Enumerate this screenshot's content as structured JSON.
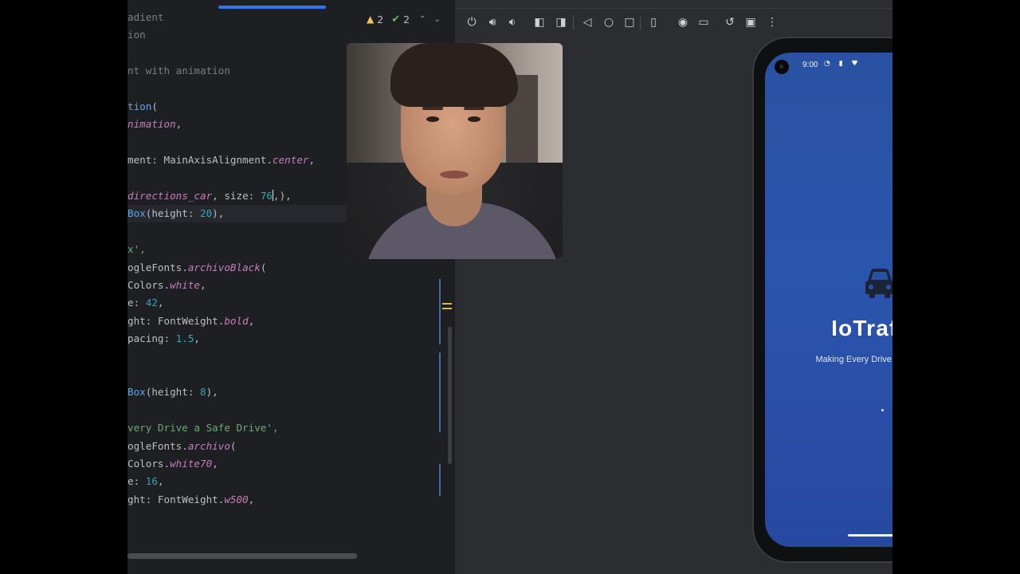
{
  "editor": {
    "lines": [
      [
        {
          "t": "adient",
          "c": "c-comment"
        }
      ],
      [
        {
          "t": "ion",
          "c": "c-comment"
        }
      ],
      [],
      [
        {
          "t": "nt with animation",
          "c": "c-comment"
        }
      ],
      [],
      [
        {
          "t": "tion",
          "c": "c-func"
        },
        {
          "t": "(",
          "c": "c-ident"
        }
      ],
      [
        {
          "t": "nimation",
          "c": "c-prop"
        },
        {
          "t": ",",
          "c": "c-ident"
        }
      ],
      [],
      [
        {
          "t": "ment: MainAxisAlignment.",
          "c": "c-ident"
        },
        {
          "t": "center",
          "c": "c-prop"
        },
        {
          "t": ",",
          "c": "c-ident"
        }
      ],
      [],
      [
        {
          "t": "directions_car",
          "c": "c-italic-prop"
        },
        {
          "t": ", size: ",
          "c": "c-ident"
        },
        {
          "t": "76",
          "c": "c-num"
        },
        {
          "t": "CARET"
        },
        {
          "t": ",),",
          "c": "c-ident"
        }
      ],
      [
        {
          "t": "Box",
          "c": "c-func"
        },
        {
          "t": "(height: ",
          "c": "c-ident"
        },
        {
          "t": "20",
          "c": "c-num"
        },
        {
          "t": "),",
          "c": "c-ident"
        }
      ],
      [],
      [
        {
          "t": "x',",
          "c": "c-str"
        }
      ],
      [
        {
          "t": "ogleFonts.",
          "c": "c-ident"
        },
        {
          "t": "archivoBlack",
          "c": "c-italic-prop"
        },
        {
          "t": "(",
          "c": "c-ident"
        }
      ],
      [
        {
          "t": "Colors.",
          "c": "c-ident"
        },
        {
          "t": "white",
          "c": "c-italic-prop"
        },
        {
          "t": ",",
          "c": "c-ident"
        }
      ],
      [
        {
          "t": "e: ",
          "c": "c-ident"
        },
        {
          "t": "42",
          "c": "c-num"
        },
        {
          "t": ",",
          "c": "c-ident"
        }
      ],
      [
        {
          "t": "ght: FontWeight.",
          "c": "c-ident"
        },
        {
          "t": "bold",
          "c": "c-italic-prop"
        },
        {
          "t": ",",
          "c": "c-ident"
        }
      ],
      [
        {
          "t": "pacing: ",
          "c": "c-ident"
        },
        {
          "t": "1.5",
          "c": "c-num"
        },
        {
          "t": ",",
          "c": "c-ident"
        }
      ],
      [],
      [],
      [
        {
          "t": "Box",
          "c": "c-func"
        },
        {
          "t": "(height: ",
          "c": "c-ident"
        },
        {
          "t": "8",
          "c": "c-num"
        },
        {
          "t": "),",
          "c": "c-ident"
        }
      ],
      [],
      [
        {
          "t": "very Drive a Safe Drive',",
          "c": "c-str"
        }
      ],
      [
        {
          "t": "ogleFonts.",
          "c": "c-ident"
        },
        {
          "t": "archivo",
          "c": "c-italic-prop"
        },
        {
          "t": "(",
          "c": "c-ident"
        }
      ],
      [
        {
          "t": "Colors.",
          "c": "c-ident"
        },
        {
          "t": "white70",
          "c": "c-italic-prop"
        },
        {
          "t": ",",
          "c": "c-ident"
        }
      ],
      [
        {
          "t": "e: ",
          "c": "c-ident"
        },
        {
          "t": "16",
          "c": "c-num"
        },
        {
          "t": ",",
          "c": "c-ident"
        }
      ],
      [
        {
          "t": "ght: FontWeight.",
          "c": "c-ident"
        },
        {
          "t": "w500",
          "c": "c-italic-prop"
        },
        {
          "t": ",",
          "c": "c-ident"
        }
      ]
    ],
    "inspection": {
      "warnings": "2",
      "ok": "2"
    }
  },
  "emulator": {
    "toolbar_icons": [
      "power-icon",
      "volume-up-icon",
      "volume-down-icon",
      "rotate-left-icon",
      "rotate-right-icon",
      "back-icon",
      "home-icon",
      "overview-icon",
      "fold-icon",
      "screenshot-icon",
      "screen-record-icon",
      "snapshot-icon",
      "display-mode-icon",
      "more-icon"
    ],
    "phone": {
      "status_time": "9:00",
      "status_left_icons": "◔ ▮ ♥",
      "status_right_icons": "▼◢▮",
      "app_title": "IoTraffix",
      "app_tagline": "Making Every Drive a Safe Drive"
    }
  },
  "colors": {
    "screen_blue": "#2a52a2",
    "accent": "#3574f0",
    "warning": "#f2c55c",
    "ok": "#5fb865"
  }
}
